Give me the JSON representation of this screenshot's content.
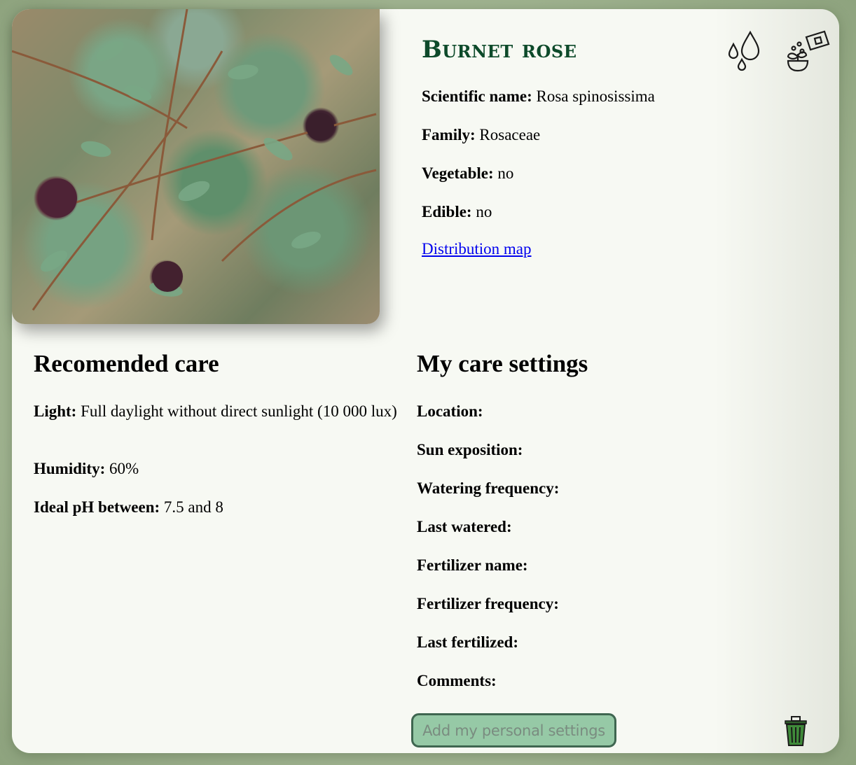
{
  "plant": {
    "common_name": "Burnet rose",
    "scientific_label": "Scientific name:",
    "scientific_value": "Rosa spinosissima",
    "family_label": "Family:",
    "family_value": "Rosaceae",
    "vegetable_label": "Vegetable:",
    "vegetable_value": "no",
    "edible_label": "Edible:",
    "edible_value": "no",
    "distribution_link": "Distribution map"
  },
  "icons": {
    "water": "water-drops-icon",
    "fertilizer": "fertilizer-bag-icon",
    "delete": "trash-icon"
  },
  "recommended": {
    "heading": "Recomended care",
    "light_label": "Light:",
    "light_value": "Full daylight without direct sunlight (10 000 lux)",
    "humidity_label": "Humidity:",
    "humidity_value": "60%",
    "ph_label": "Ideal pH between:",
    "ph_value": "7.5 and 8"
  },
  "my_care": {
    "heading": "My care settings",
    "fields": [
      "Location:",
      "Sun exposition:",
      "Watering frequency:",
      "Last watered:",
      "Fertilizer name:",
      "Fertilizer frequency:",
      "Last fertilized:",
      "Comments:"
    ],
    "add_button": "Add my personal settings"
  },
  "colors": {
    "title": "#0d4a2a",
    "button_bg": "#96c9a6",
    "button_border": "#3f6650",
    "trash": "#3f8a3a"
  }
}
